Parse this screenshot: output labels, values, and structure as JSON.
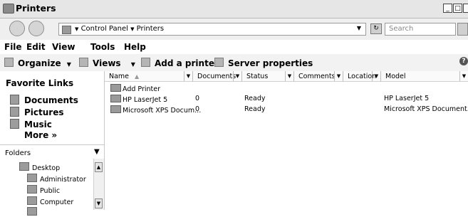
{
  "window": {
    "title": "Printers",
    "min_label": "_",
    "max_label": "□"
  },
  "address": {
    "crumb1": "Control Panel",
    "crumb2": "Printers",
    "search_placeholder": "Search"
  },
  "menu": {
    "file": "File",
    "edit": "Edit",
    "view": "View",
    "tools": "Tools",
    "help": "Help"
  },
  "commands": {
    "organize": "Organize",
    "views": "Views",
    "add_printer": "Add a printer",
    "server_properties": "Server properties"
  },
  "sidebar": {
    "favorites_title": "Favorite Links",
    "items": [
      {
        "label": "Documents"
      },
      {
        "label": "Pictures"
      },
      {
        "label": "Music"
      }
    ],
    "more": "More »",
    "folders_label": "Folders",
    "tree": [
      {
        "label": "Desktop"
      },
      {
        "label": "Administrator"
      },
      {
        "label": "Public"
      },
      {
        "label": "Computer"
      }
    ]
  },
  "columns": [
    "Name",
    "Documents",
    "Status",
    "Comments",
    "Location",
    "Model"
  ],
  "rows": [
    {
      "name": "Add Printer",
      "documents": "",
      "status": "",
      "model": ""
    },
    {
      "name": "HP LaserJet 5",
      "documents": "0",
      "status": "Ready",
      "model": "HP LaserJet 5"
    },
    {
      "name": "Microsoft XPS Docum...",
      "documents": "0",
      "status": "Ready",
      "model": "Microsoft XPS Document..."
    }
  ]
}
